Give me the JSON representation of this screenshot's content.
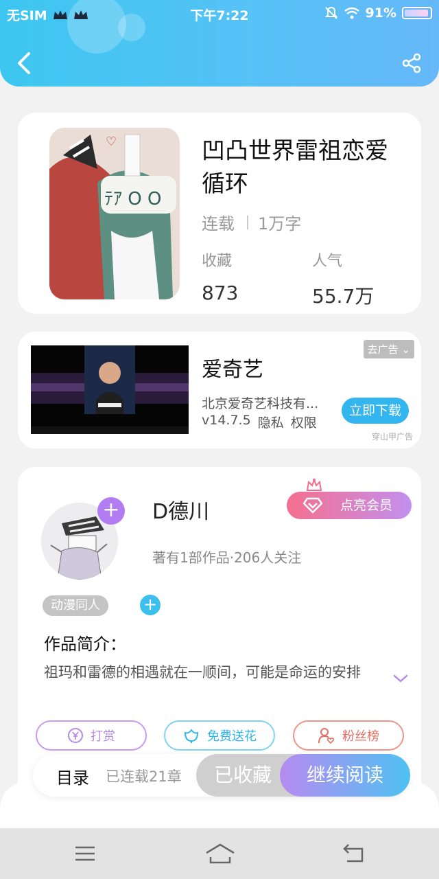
{
  "status_bar": {
    "carrier": "无SIM",
    "time": "下午7:22",
    "battery": "91%"
  },
  "book": {
    "title": "凹凸世界雷祖恋爱循环",
    "status": "连载",
    "word_count": "1万字",
    "favorites_label": "收藏",
    "favorites_value": "873",
    "popularity_label": "人气",
    "popularity_value": "55.7万"
  },
  "ad": {
    "app_name": "爱奇艺",
    "company": "北京爱奇艺科技有...",
    "version": "v14.7.5",
    "privacy": "隐私",
    "permissions": "权限",
    "close_label": "去广告",
    "download_label": "立即下载",
    "source": "穿山甲广告"
  },
  "author": {
    "name": "D德川",
    "info": "著有1部作品·206人关注",
    "vip_label": "点亮会员",
    "tag": "动漫同人",
    "intro_label": "作品简介：",
    "intro_text": "祖玛和雷德的相遇就在一顺间，可能是命运的安排"
  },
  "actions": {
    "reward": "打赏",
    "flower": "免费送花",
    "fans": "粉丝榜"
  },
  "bottom": {
    "toc": "目录",
    "chapters": "已连载21章",
    "collected": "已收藏",
    "continue": "继续阅读"
  },
  "colors": {
    "header_start": "#3cc6f0",
    "header_end": "#66b8f8",
    "accent_purple": "#b27cf2",
    "accent_blue": "#33b5ef"
  }
}
